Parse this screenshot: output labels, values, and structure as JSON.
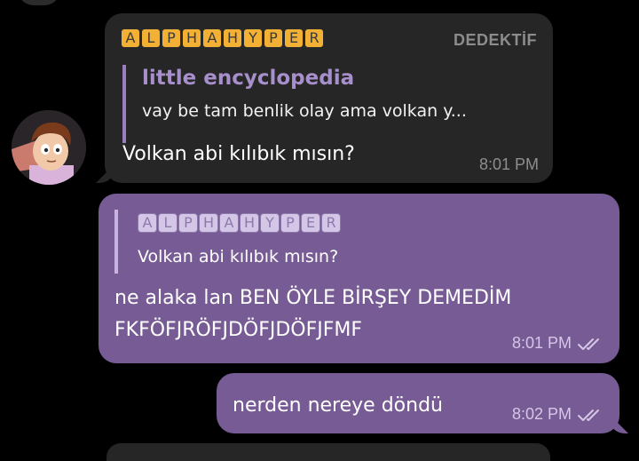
{
  "colors": {
    "background": "#000000",
    "incoming_bubble": "#262626",
    "outgoing_bubble": "#775b94",
    "sender_tag_fill": "#f2b134",
    "reply_author": "#a78fcc"
  },
  "messages": {
    "incoming": {
      "sender_letters": [
        "A",
        "L",
        "P",
        "H",
        "A",
        "H",
        "Y",
        "P",
        "E",
        "R"
      ],
      "role": "DEDEKTİF",
      "reply_author": "little encyclopedia",
      "reply_snippet": "vay be tam benlik olay ama volkan y...",
      "text": "Volkan abi kılıbık mısın?",
      "time": "8:01 PM",
      "avatar_icon": "avatar-cartoon-boy"
    },
    "outgoing_1": {
      "reply_sender_letters": [
        "A",
        "L",
        "P",
        "H",
        "A",
        "H",
        "Y",
        "P",
        "E",
        "R"
      ],
      "reply_snippet": "Volkan abi kılıbık mısın?",
      "text_line1": "ne alaka lan BEN ÖYLE BİRŞEY DEMEDİM",
      "text_line2": "FKFÖFJRÖFJDÖFJDÖFJFMF",
      "time": "8:01 PM",
      "status_icon": "double-check-icon"
    },
    "outgoing_2": {
      "text": "nerden nereye döndü",
      "time": "8:02 PM",
      "status_icon": "double-check-icon"
    }
  }
}
